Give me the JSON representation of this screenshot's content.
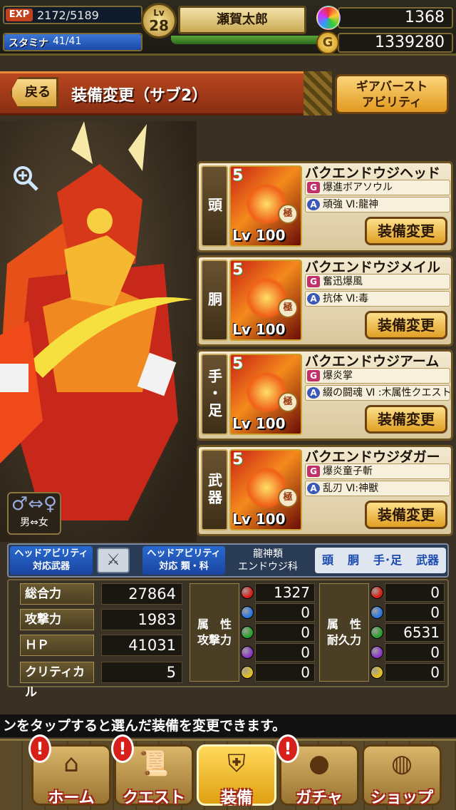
{
  "status": {
    "exp_label": "EXP",
    "exp_value": "2172/5189",
    "stamina_label": "スタミナ",
    "stamina_value": "41/41",
    "stamina_fraction": 1.0,
    "level_label": "Lv",
    "level": "28",
    "player_name": "瀬賀太郎",
    "gems": "1368",
    "gold_symbol": "G",
    "gold": "1339280"
  },
  "header": {
    "back_label": "戻る",
    "title": "装備変更（サブ2）",
    "gear_burst_line1": "ギアバースト",
    "gear_burst_line2": "アビリティ"
  },
  "character": {
    "zoom_icon": "zoom-in-icon",
    "gender_symbol": "♂⇔♀",
    "gender_label": "男⇔女"
  },
  "slots": [
    {
      "part": "頭",
      "name": "バクエンドウジヘッド",
      "rarity": "5",
      "seal": "極",
      "level": "Lv 100",
      "skill1_tag": "G",
      "skill1": "爆進ボアソウル",
      "skill2_tag": "A",
      "skill2": "頑強 Ⅵ:龍神",
      "button": "装備変更"
    },
    {
      "part": "胴",
      "name": "バクエンドウジメイル",
      "rarity": "5",
      "seal": "極",
      "level": "Lv 100",
      "skill1_tag": "G",
      "skill1": "奮迅爆風",
      "skill2_tag": "A",
      "skill2": "抗体 Ⅵ:毒",
      "button": "装備変更"
    },
    {
      "part": "手・足",
      "name": "バクエンドウジアーム",
      "rarity": "5",
      "seal": "極",
      "level": "Lv 100",
      "skill1_tag": "G",
      "skill1": "爆炎掌",
      "skill2_tag": "A",
      "skill2": "綴の闘魂 Ⅵ :木属性クエスト",
      "button": "装備変更"
    },
    {
      "part": "武器",
      "name": "バクエンドウジダガー",
      "rarity": "5",
      "seal": "極",
      "level": "Lv 100",
      "skill1_tag": "G",
      "skill1": "爆炎童子斬",
      "skill2_tag": "A",
      "skill2": "乱刃 Ⅵ:神獣",
      "button": "装備変更"
    }
  ],
  "abilities": {
    "weapon_line1": "ヘッドアビリティ",
    "weapon_line2": "対応武器",
    "weapon_icon": "dagger-icon",
    "type_line1": "ヘッドアビリティ",
    "type_line2": "対応 類・科",
    "type_value1": "龍神類",
    "type_value2": "エンドウジ科",
    "parts": [
      "頭",
      "胴",
      "手･足",
      "武器"
    ]
  },
  "stats": {
    "rows": [
      {
        "label": "総合力",
        "value": "27864"
      },
      {
        "label": "攻撃力",
        "value": "1983"
      },
      {
        "label": "ＨＰ",
        "value": "41031"
      },
      {
        "label": "クリティカル",
        "value": "5"
      }
    ],
    "attack_attr_line1": "属　性",
    "attack_attr_line2": "攻撃力",
    "attack_values": [
      "1327",
      "0",
      "0",
      "0",
      "0"
    ],
    "defense_attr_line1": "属　性",
    "defense_attr_line2": "耐久力",
    "defense_values": [
      "0",
      "0",
      "6531",
      "0",
      "0"
    ],
    "orb_colors": [
      "#d8201a",
      "#2a78e0",
      "#2aa030",
      "#8a38c8",
      "#e0c020"
    ]
  },
  "message": "ンをタップすると選んだ装備を変更できます。",
  "nav": [
    {
      "label": "ホーム",
      "icon": "house-icon",
      "alert": "!"
    },
    {
      "label": "クエスト",
      "icon": "scroll-icon",
      "alert": "!"
    },
    {
      "label": "装備",
      "icon": "shield-icon",
      "alert": ""
    },
    {
      "label": "ガチャ",
      "icon": "gacha-icon",
      "alert": "!"
    },
    {
      "label": "ショップ",
      "icon": "bag-icon",
      "alert": ""
    }
  ]
}
